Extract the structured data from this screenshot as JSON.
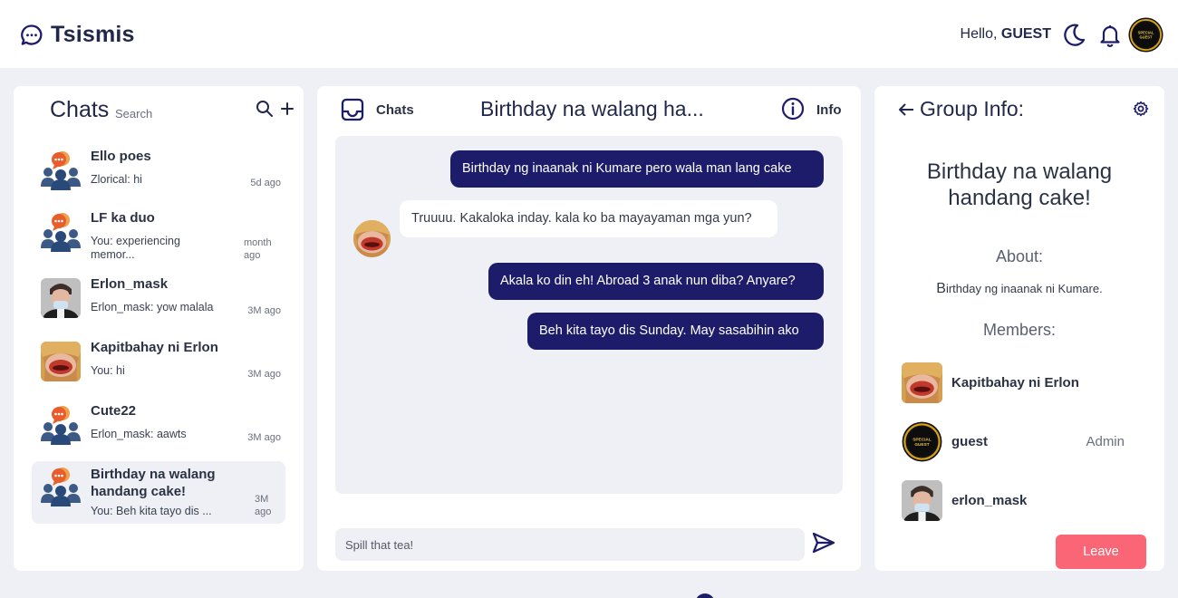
{
  "app": {
    "name": "Tsismis"
  },
  "header": {
    "greeting": "Hello,",
    "username": "GUEST",
    "avatar_text_1": "SPECIAL",
    "avatar_text_2": "GUEST"
  },
  "colors": {
    "primary": "#1d1c6b",
    "leave": "#fb6676",
    "background": "#eef0f5",
    "chat_icon_bubble": "#e85d2b"
  },
  "sidebar": {
    "title": "Chats",
    "search_placeholder": "Search",
    "search_icon": "search-icon",
    "add_icon": "plus-icon",
    "chats": [
      {
        "name": "Ello poes",
        "last": "Zlorical: hi",
        "time": "5d ago",
        "avatar": "group-icon"
      },
      {
        "name": "LF ka duo",
        "last": "You: experiencing memor...",
        "time": "month ago",
        "avatar": "group-icon"
      },
      {
        "name": "Erlon_mask",
        "last": "Erlon_mask: yow malala",
        "time": "3M ago",
        "avatar": "man-photo"
      },
      {
        "name": "Kapitbahay ni Erlon",
        "last": "You: hi",
        "time": "3M ago",
        "avatar": "lips-photo"
      },
      {
        "name": "Cute22",
        "last": "Erlon_mask: aawts",
        "time": "3M ago",
        "avatar": "group-icon"
      },
      {
        "name": "Birthday na walang handang cake!",
        "last": "You: Beh kita tayo dis ...",
        "time": "3M ago",
        "avatar": "group-icon",
        "active": true
      }
    ]
  },
  "conversation": {
    "tab_label": "Chats",
    "title": "Birthday na walang ha...",
    "info_label": "Info",
    "messages": [
      {
        "from": "me",
        "text": "Birthday ng inaanak ni Kumare pero wala man lang cake"
      },
      {
        "from": "other",
        "text": "Truuuu. Kakaloka inday. kala ko ba mayayaman mga yun?"
      },
      {
        "from": "me",
        "text": "Akala ko din eh! Abroad 3 anak nun diba? Anyare?"
      },
      {
        "from": "me",
        "text": "Beh kita tayo dis Sunday. May sasabihin ako"
      }
    ],
    "input_placeholder": "Spill that tea!",
    "send_icon": "send-icon"
  },
  "group_info": {
    "title": "Group Info:",
    "back_icon": "arrow-left-icon",
    "settings_icon": "gear-icon",
    "group_name": "Birthday na walang handang cake!",
    "about_label": "About:",
    "about_text_first": "B",
    "about_text_rest": "irthday ng inaanak ni Kumare.",
    "members_label": "Members:",
    "members": [
      {
        "name": "Kapitbahay ni Erlon",
        "role": "",
        "avatar": "lips-photo"
      },
      {
        "name": "guest",
        "role": "Admin",
        "avatar": "special-guest-badge"
      },
      {
        "name": "erlon_mask",
        "role": "",
        "avatar": "man-photo"
      }
    ],
    "leave_label": "Leave"
  }
}
